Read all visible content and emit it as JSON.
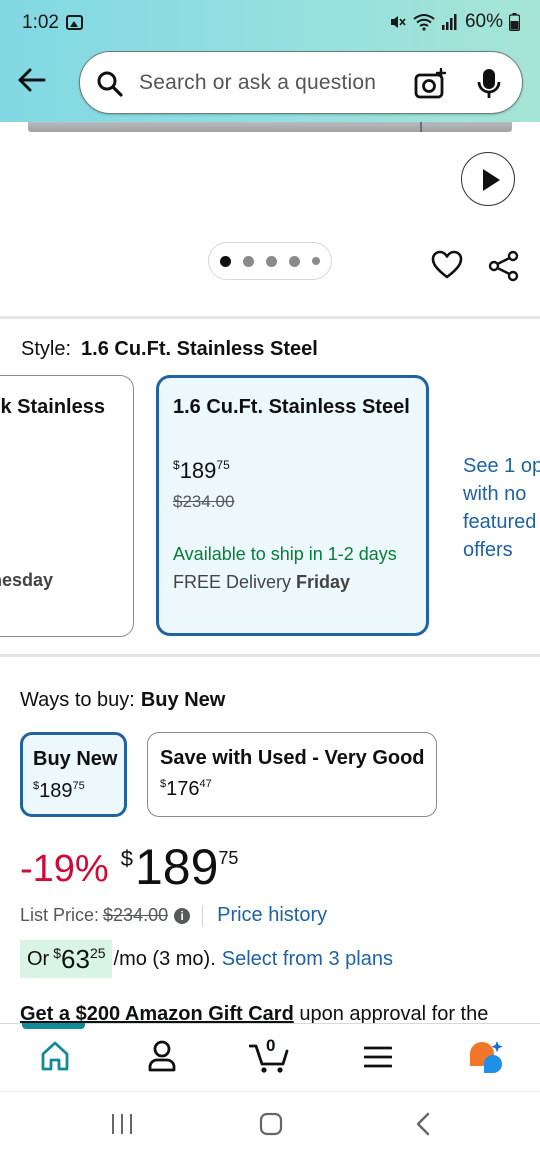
{
  "status_bar": {
    "time": "1:02",
    "battery": "60%"
  },
  "search": {
    "placeholder": "Search or ask a question"
  },
  "carousel": {
    "total_images": 5,
    "active_index": 0
  },
  "style": {
    "label": "Style:",
    "selected": "1.6 Cu.Ft. Stainless Steel"
  },
  "style_options": {
    "prev_partial": {
      "name": "k Stainless",
      "delivery": "nesday"
    },
    "selected": {
      "name": "1.6 Cu.Ft. Stainless Steel",
      "price_currency": "$",
      "price_whole": "189",
      "price_fraction": "75",
      "list_price": "$234.00",
      "availability": "Available to ship in 1-2 days",
      "delivery_prefix": "FREE Delivery ",
      "delivery_day": "Friday"
    },
    "see_more": {
      "line1": "See 1 op",
      "line2": "with no",
      "line3": "featured",
      "line4": "offers"
    }
  },
  "ways_to_buy": {
    "label": "Ways to buy:",
    "selected": "Buy New",
    "options": [
      {
        "title": "Buy New",
        "currency": "$",
        "whole": "189",
        "fraction": "75"
      },
      {
        "title": "Save with Used - Very Good",
        "currency": "$",
        "whole": "176",
        "fraction": "47"
      }
    ]
  },
  "price": {
    "discount": "-19%",
    "currency": "$",
    "whole": "189",
    "fraction": "75",
    "list_label": "List Price:",
    "list_value": "$234.00",
    "history_link": "Price history"
  },
  "monthly": {
    "prefix": "Or",
    "currency": "$",
    "whole": "63",
    "fraction": "25",
    "suffix": "/mo (3 mo).",
    "plans_link": "Select from 3 plans"
  },
  "gift_card": {
    "bold": "Get a $200 Amazon Gift Card",
    "rest": " upon approval for the"
  },
  "bottom_nav": {
    "cart_count": "0",
    "items": [
      "home-icon",
      "account-icon",
      "cart-icon",
      "menu-icon",
      "rufus-icon"
    ]
  },
  "colors": {
    "accent_blue": "#2162a1",
    "discount_red": "#cc0c39",
    "available_green": "#067d3a",
    "header_teal": "#93dfe0"
  }
}
